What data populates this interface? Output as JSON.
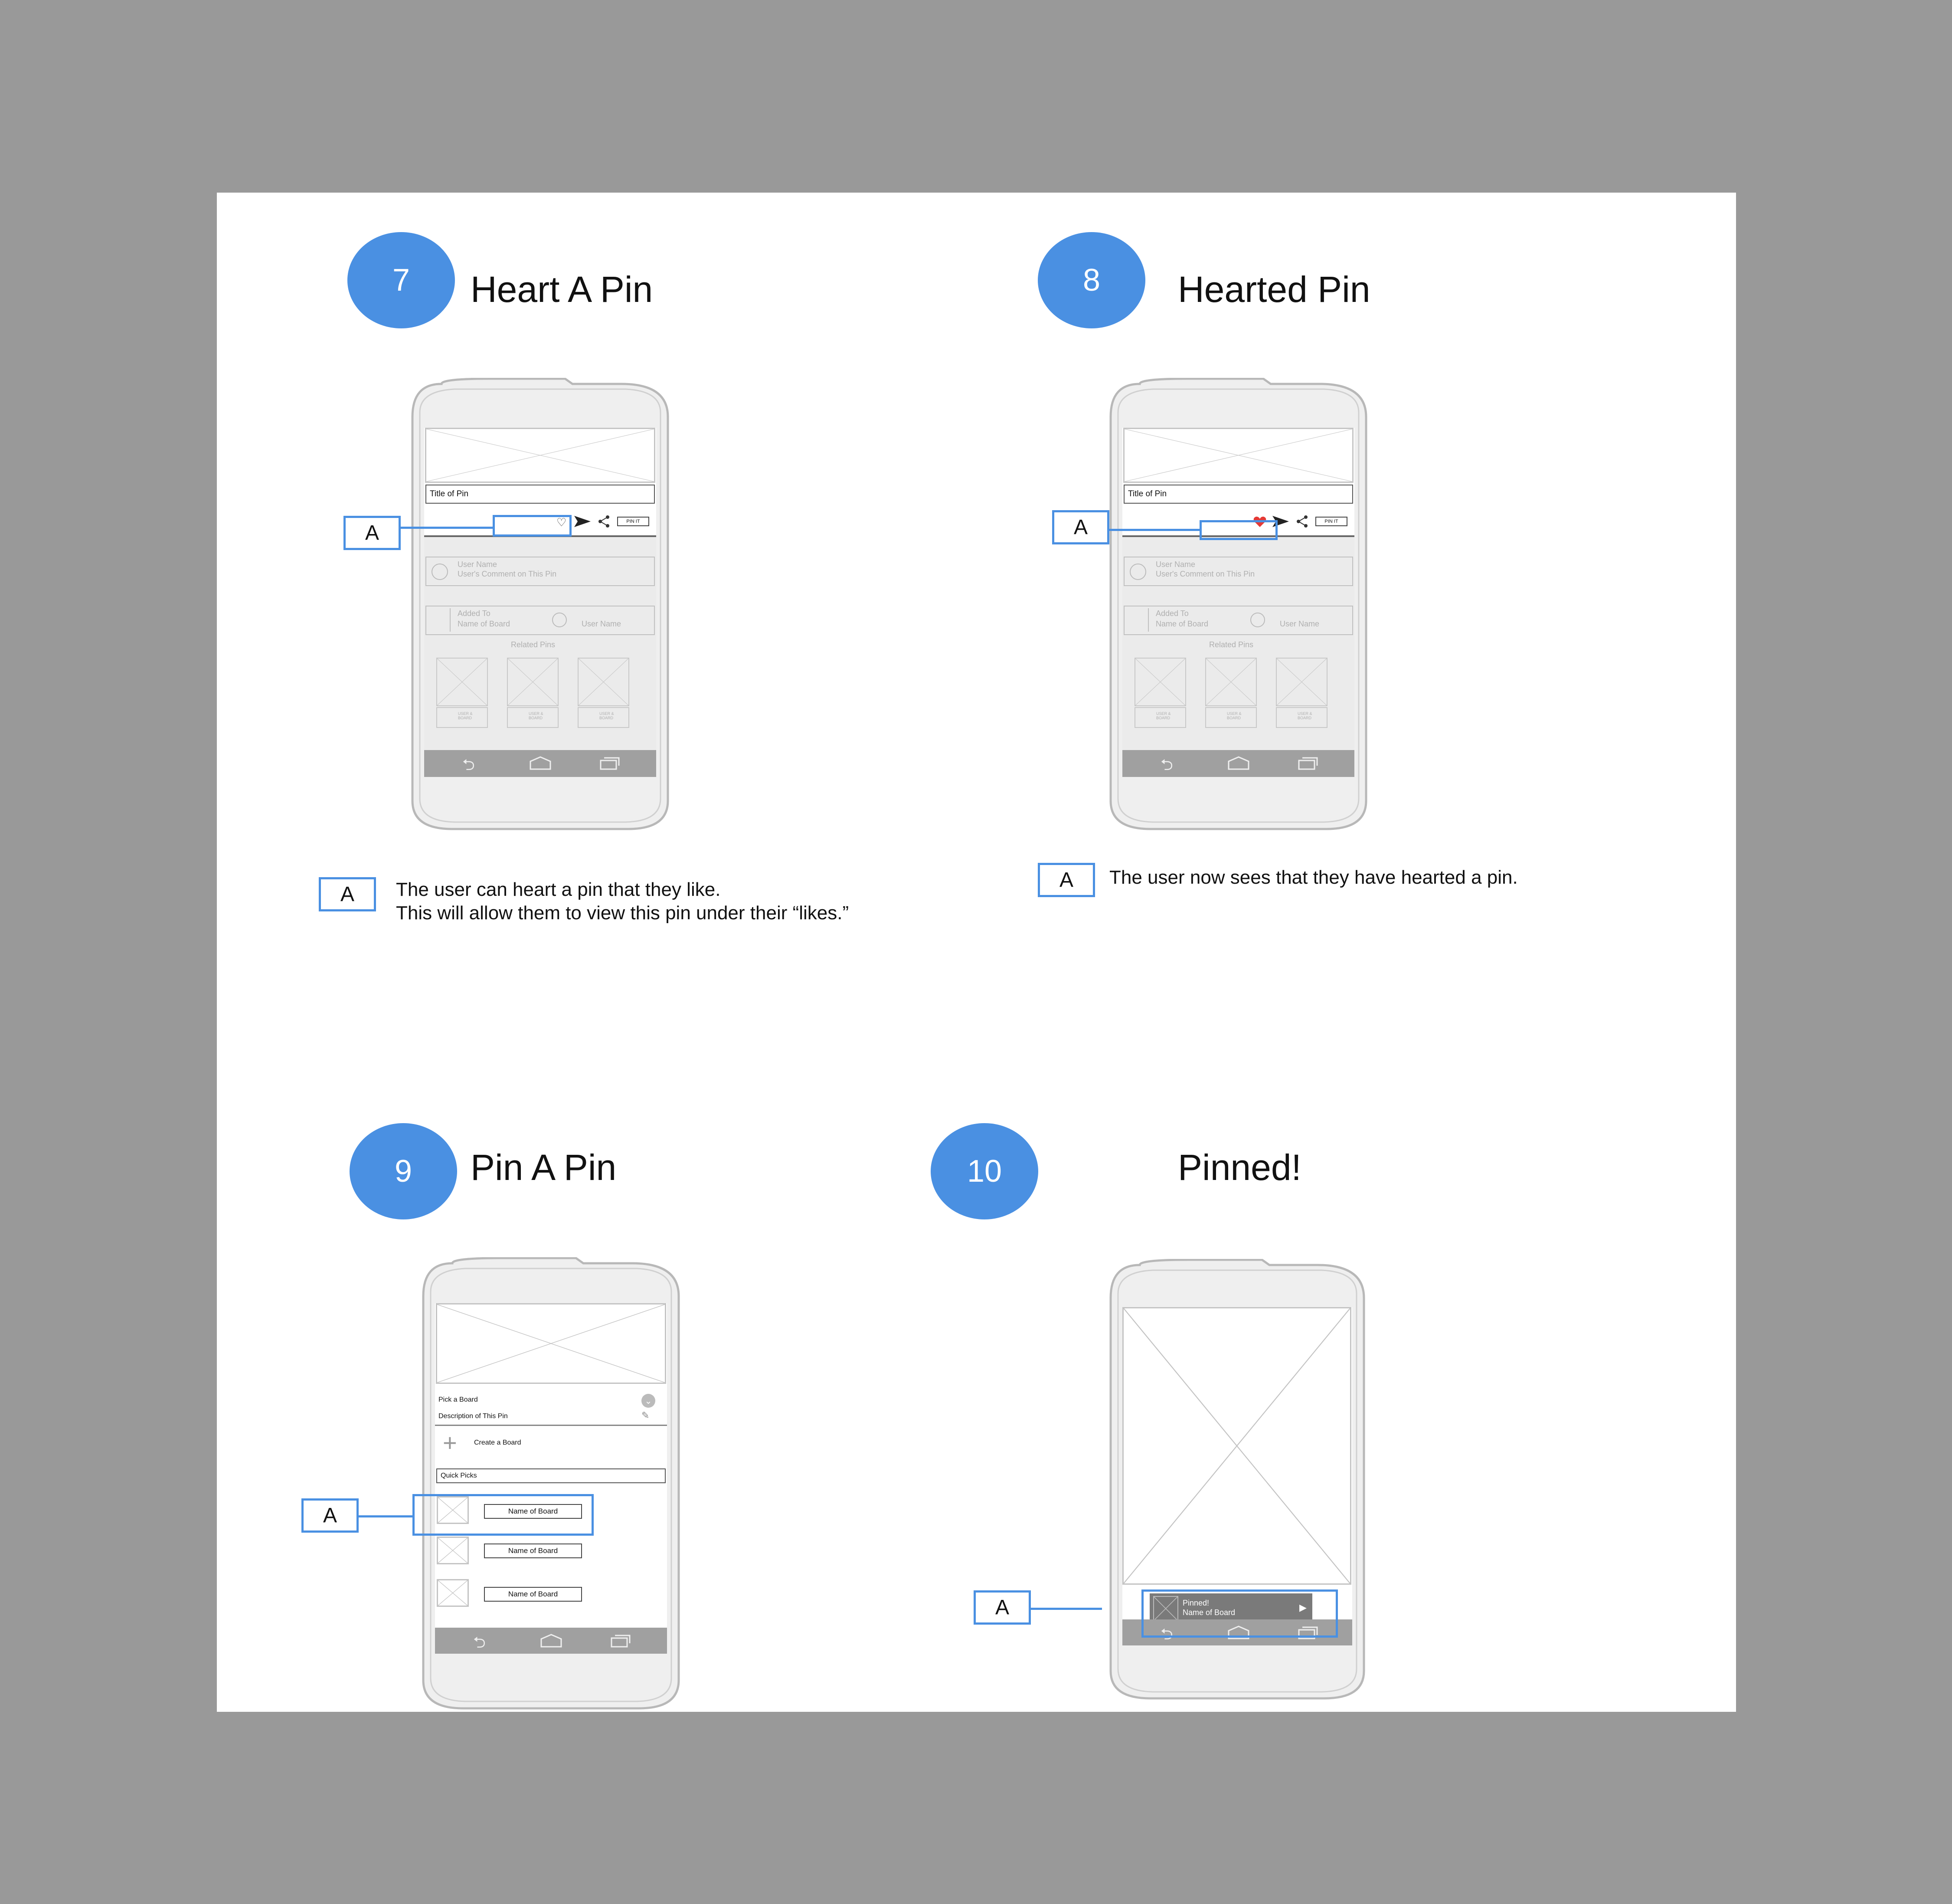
{
  "colors": {
    "accent": "#4a90e2",
    "background": "#999999",
    "sheet": "#ffffff",
    "heart": "#e53935"
  },
  "steps": [
    {
      "number": "7",
      "title": "Heart A Pin",
      "marker": "A",
      "description": [
        "The user can heart a pin that they like.",
        "This will allow them to view this pin under their “likes.”"
      ]
    },
    {
      "number": "8",
      "title": "Hearted Pin",
      "marker": "A",
      "description": [
        "The user now sees that they have hearted a pin."
      ]
    },
    {
      "number": "9",
      "title": "Pin A Pin",
      "marker": "A"
    },
    {
      "number": "10",
      "title": "Pinned!",
      "marker": "A"
    }
  ],
  "pin_screen": {
    "title": "Title of Pin",
    "pin_it": "PIN IT",
    "user_name": "User Name",
    "user_comment": "User's Comment on This Pin",
    "added_to": "Added To",
    "name_of_board": "Name of Board",
    "related_pins": "Related Pins",
    "user_board": "USER & BOARD",
    "icons": [
      "heart-outline-icon",
      "send-icon",
      "share-icon",
      "heart-filled-icon",
      "back-icon",
      "home-icon",
      "recents-icon"
    ]
  },
  "board_screen": {
    "pick_board": "Pick a Board",
    "description": "Description of This Pin",
    "create_board": "Create a Board",
    "quick_picks": "Quick Picks",
    "boards": [
      "Name of Board",
      "Name of Board",
      "Name of Board"
    ]
  },
  "pinned_screen": {
    "pinned": "Pinned!",
    "board": "Name of Board"
  }
}
